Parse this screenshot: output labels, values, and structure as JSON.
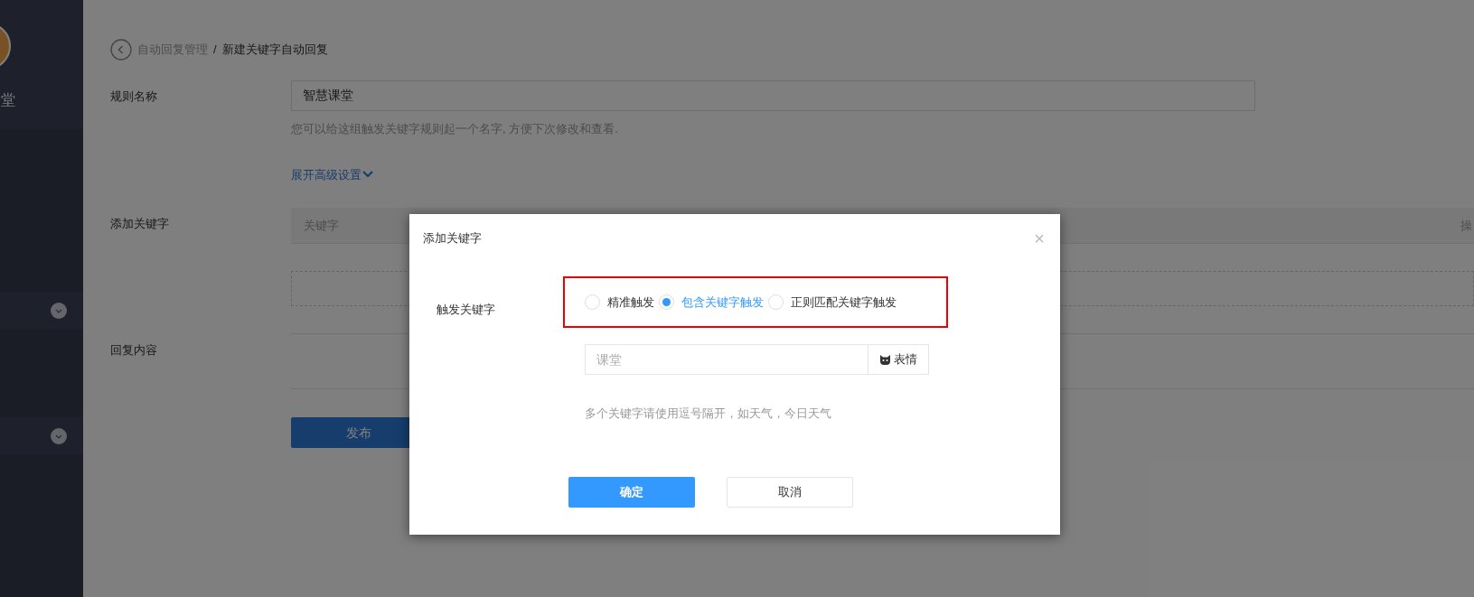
{
  "sidebar": {
    "user_name": "堂",
    "menu_groups": [
      {
        "expanded": false
      },
      {
        "expanded": false
      }
    ]
  },
  "breadcrumb": {
    "parent": "自动回复管理",
    "separator": "/",
    "current": "新建关键字自动回复"
  },
  "form": {
    "rule_name": {
      "label": "规则名称",
      "value": "智慧课堂",
      "hint": "您可以给这组触发关键字规则起一个名字, 方便下次修改和查看."
    },
    "advanced_link": "展开高级设置",
    "keywords": {
      "label": "添加关键字",
      "columns": [
        "关键字",
        "操"
      ]
    },
    "reply": {
      "label": "回复内容"
    },
    "publish_button": "发布"
  },
  "dialog": {
    "title": "添加关键字",
    "close": "×",
    "trigger_label": "触发关键字",
    "trigger_options": [
      {
        "label": "精准触发",
        "selected": false
      },
      {
        "label": "包含关键字触发",
        "selected": true
      },
      {
        "label": "正则匹配关键字触发",
        "selected": false
      }
    ],
    "keyword_input": {
      "placeholder": "课堂"
    },
    "emoji_button": "表情",
    "hint": "多个关键字请使用逗号隔开，如天气，今日天气",
    "confirm_button": "确定",
    "cancel_button": "取消"
  }
}
